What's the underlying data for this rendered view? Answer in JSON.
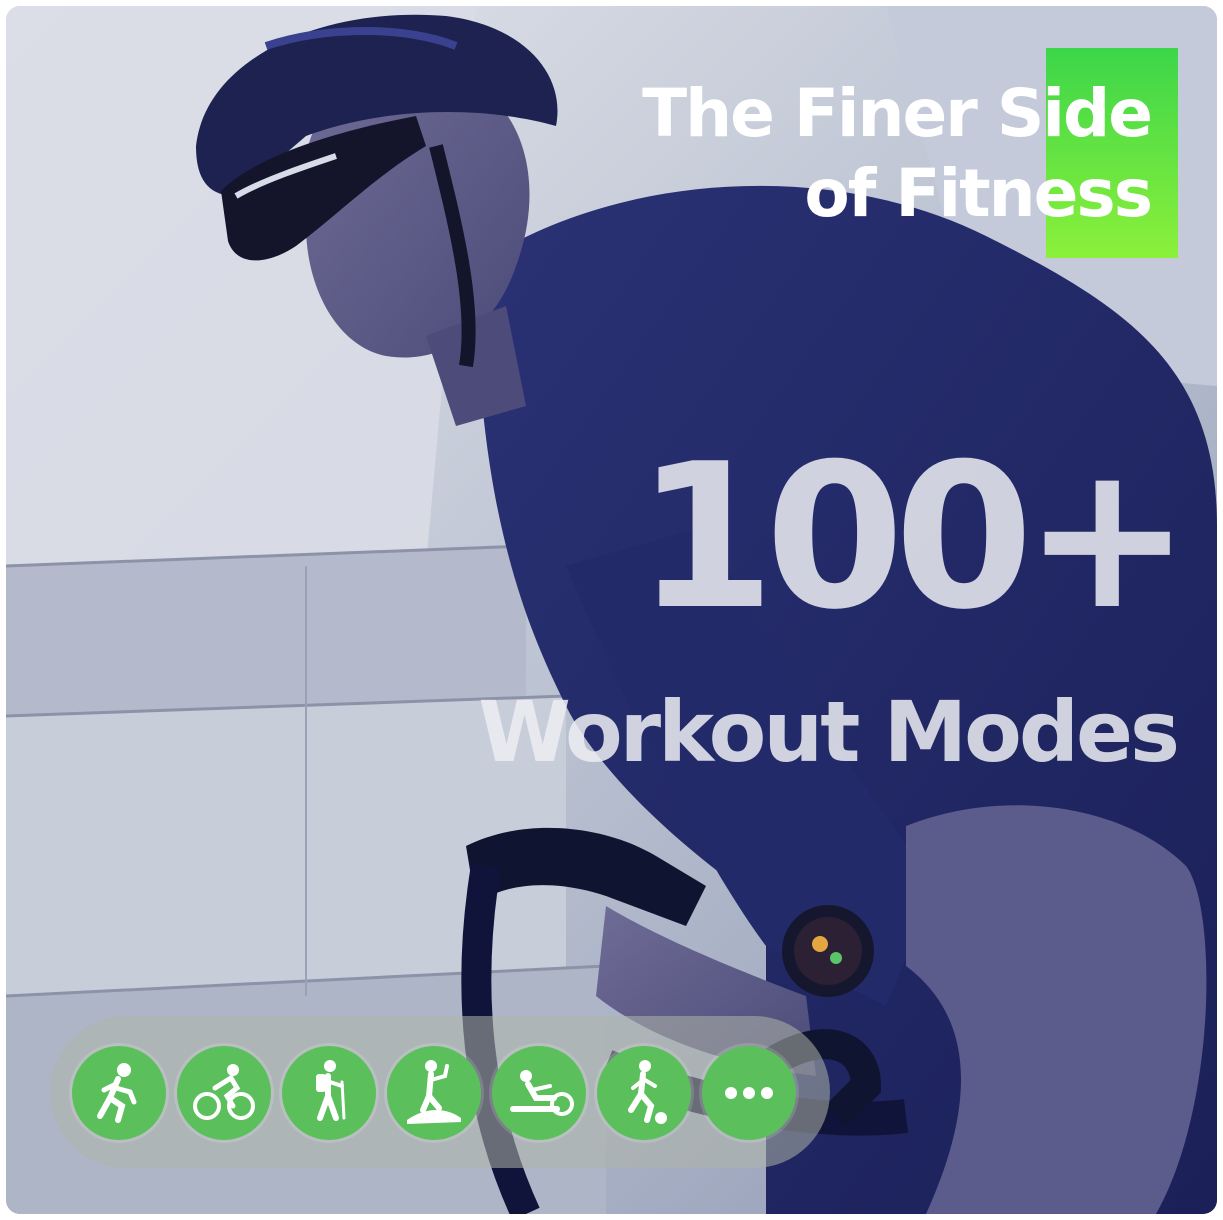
{
  "headline": {
    "line1": "The Finer Side",
    "line2": "of Fitness"
  },
  "feature": {
    "count": "100+",
    "label": "Workout Modes"
  },
  "workout_modes": [
    {
      "icon": "running-icon"
    },
    {
      "icon": "cycling-icon"
    },
    {
      "icon": "hiking-icon"
    },
    {
      "icon": "elliptical-icon"
    },
    {
      "icon": "rowing-machine-icon"
    },
    {
      "icon": "soccer-icon"
    },
    {
      "icon": "more-icon"
    }
  ],
  "colors": {
    "accent_green": "#5bc05c",
    "headline_highlight": "#5fe040",
    "text_white": "#ffffff"
  }
}
